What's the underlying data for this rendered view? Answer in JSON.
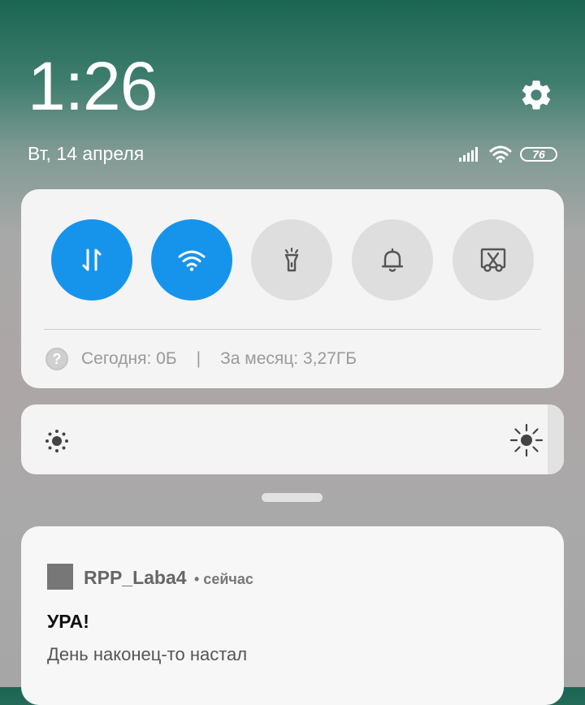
{
  "header": {
    "time": "1:26",
    "date": "Вт, 14 апреля",
    "battery_level": "76"
  },
  "quick_toggles": [
    {
      "name": "mobile-data",
      "state": "on",
      "icon": "data-transfer-icon"
    },
    {
      "name": "wifi",
      "state": "on",
      "icon": "wifi-icon"
    },
    {
      "name": "flashlight",
      "state": "off",
      "icon": "flashlight-icon"
    },
    {
      "name": "sound",
      "state": "off",
      "icon": "bell-icon"
    },
    {
      "name": "screenshot",
      "state": "off",
      "icon": "screenshot-scissors-icon"
    }
  ],
  "data_usage": {
    "help_icon": "?",
    "today": "Сегодня: 0Б",
    "separator": "|",
    "month": "За месяц: 3,27ГБ"
  },
  "brightness": {
    "level": 0.97
  },
  "notification": {
    "app_name": "RPP_Laba4",
    "time": "• сейчас",
    "title": "УРА!",
    "text": "День наконец-то настал"
  },
  "colors": {
    "accent": "#1694ec",
    "tile_off": "#dedede",
    "panel_bg": "#f4f4f4"
  }
}
